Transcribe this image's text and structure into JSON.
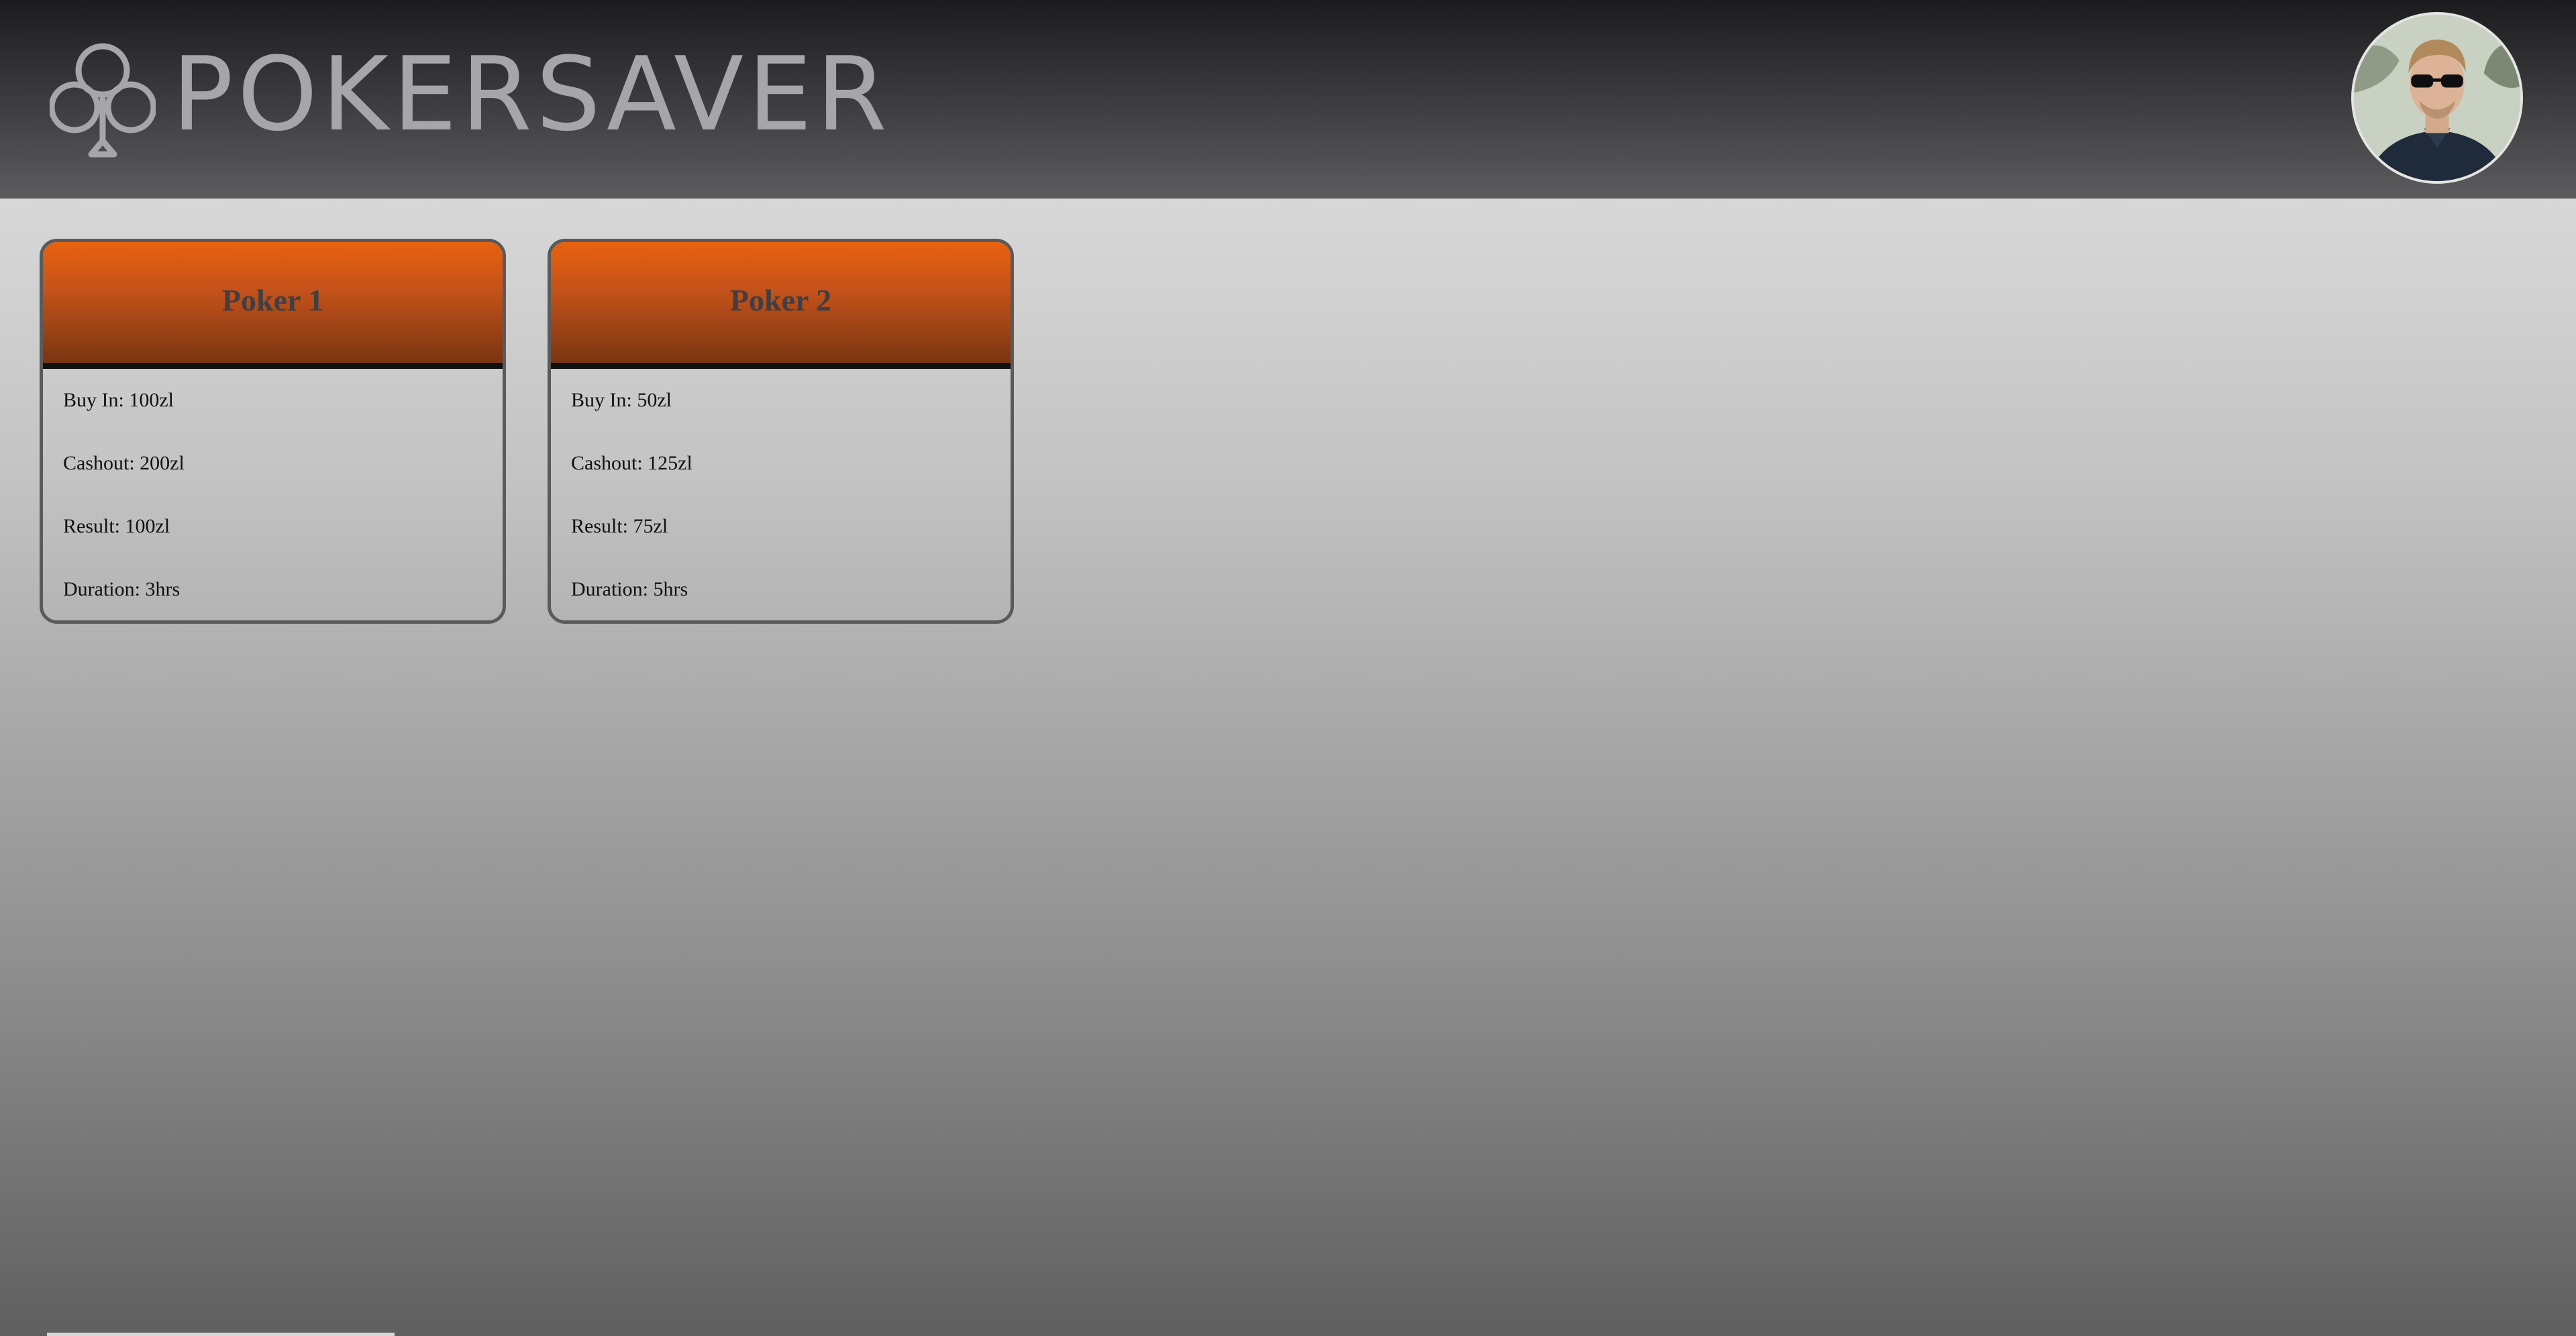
{
  "app": {
    "brand": "POKERSAVER",
    "logo_icon": "club-icon",
    "avatar_icon": "user-avatar"
  },
  "colors": {
    "header_dark": "#1c1c1e",
    "card_orange": "#e8620f",
    "card_border": "#5a5a5a",
    "title_text": "#3f3f44"
  },
  "sessions": [
    {
      "title": "Poker 1",
      "buy_in": "Buy In: 100zl",
      "cashout": "Cashout: 200zl",
      "result": "Result: 100zl",
      "duration": "Duration: 3hrs"
    },
    {
      "title": "Poker 2",
      "buy_in": "Buy In: 50zl",
      "cashout": "Cashout: 125zl",
      "result": "Result: 75zl",
      "duration": "Duration: 5hrs"
    }
  ]
}
